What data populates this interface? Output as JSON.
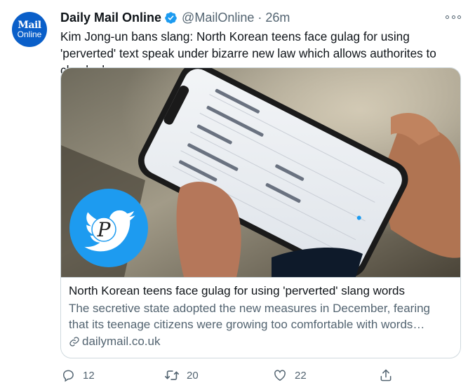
{
  "account": {
    "avatar_line1": "Mail",
    "avatar_line2": "Online",
    "name": "Daily Mail Online",
    "handle": "@MailOnline",
    "separator": "·",
    "time": "26m"
  },
  "tweet": {
    "text": "Kim Jong-un bans slang: North Korean teens face gulag for using 'perverted' text speak under bizarre new law which allows authorites to check phones"
  },
  "card": {
    "title": "North Korean teens face gulag for using 'perverted' slang words",
    "description": "The secretive state adopted the new measures in December, fearing that its teenage citizens were growing too comfortable with words popular i...",
    "domain": "dailymail.co.uk",
    "overlay_letter": "P"
  },
  "actions": {
    "replies": "12",
    "retweets": "20",
    "likes": "22"
  },
  "colors": {
    "verified": "#1d9bf0",
    "muted": "#536471",
    "avatar_bg": "#0a5fc9",
    "twitter_circle": "#1d9bf0"
  },
  "icons": [
    "verified-badge-icon",
    "more-icon",
    "link-icon",
    "reply-icon",
    "retweet-icon",
    "like-icon",
    "share-icon",
    "twitter-bird-icon"
  ]
}
